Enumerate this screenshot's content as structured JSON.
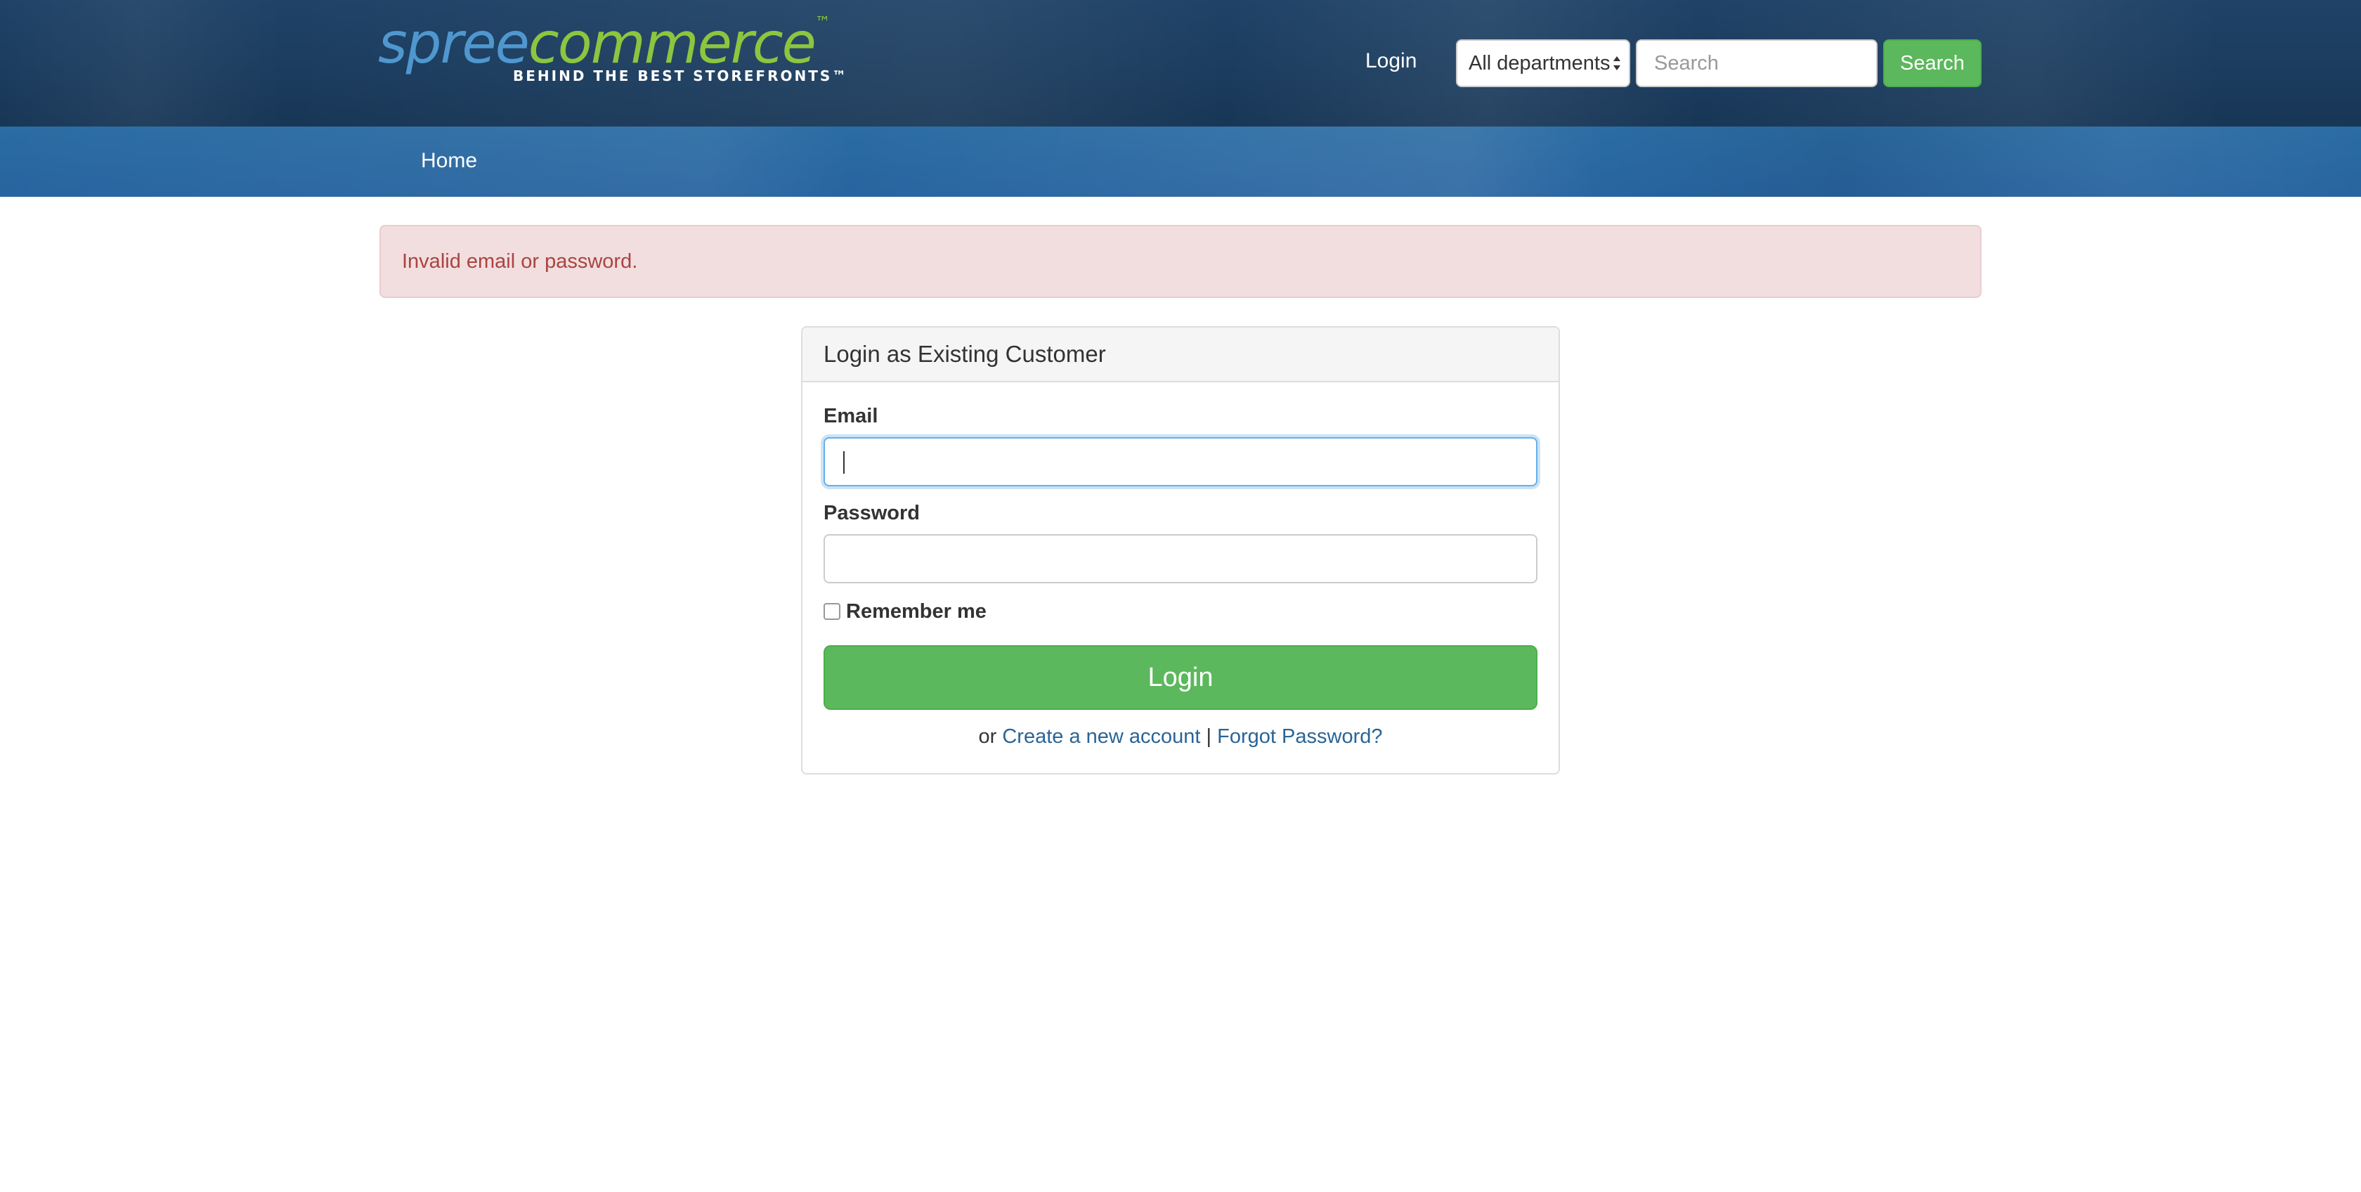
{
  "header": {
    "logo": {
      "word_spree": "spree",
      "word_commerce": "commerce",
      "trademark": "™",
      "tagline": "BEHIND THE BEST STOREFRONTS™"
    },
    "login_link": "Login",
    "department_select": {
      "selected": "All departments"
    },
    "search": {
      "placeholder": "Search",
      "value": "",
      "button_label": "Search"
    }
  },
  "main_nav": {
    "items": [
      {
        "label": "Home"
      }
    ]
  },
  "alert": {
    "message": "Invalid email or password."
  },
  "login_panel": {
    "title": "Login as Existing Customer",
    "email_label": "Email",
    "email_value": "",
    "password_label": "Password",
    "password_value": "",
    "remember_label": "Remember me",
    "remember_checked": false,
    "submit_label": "Login",
    "or_text": "or",
    "create_account_link": "Create a new account",
    "separator": "|",
    "forgot_password_link": "Forgot Password?"
  },
  "colors": {
    "header_bg": "#1f4266",
    "nav_bg": "#2b6ca3",
    "brand_blue": "#4f97cf",
    "brand_green": "#8cc63f",
    "button_green": "#5cb85c",
    "alert_bg": "#f2dede",
    "alert_text": "#a94442",
    "link": "#2a6496",
    "focus_border": "#66afe9"
  }
}
